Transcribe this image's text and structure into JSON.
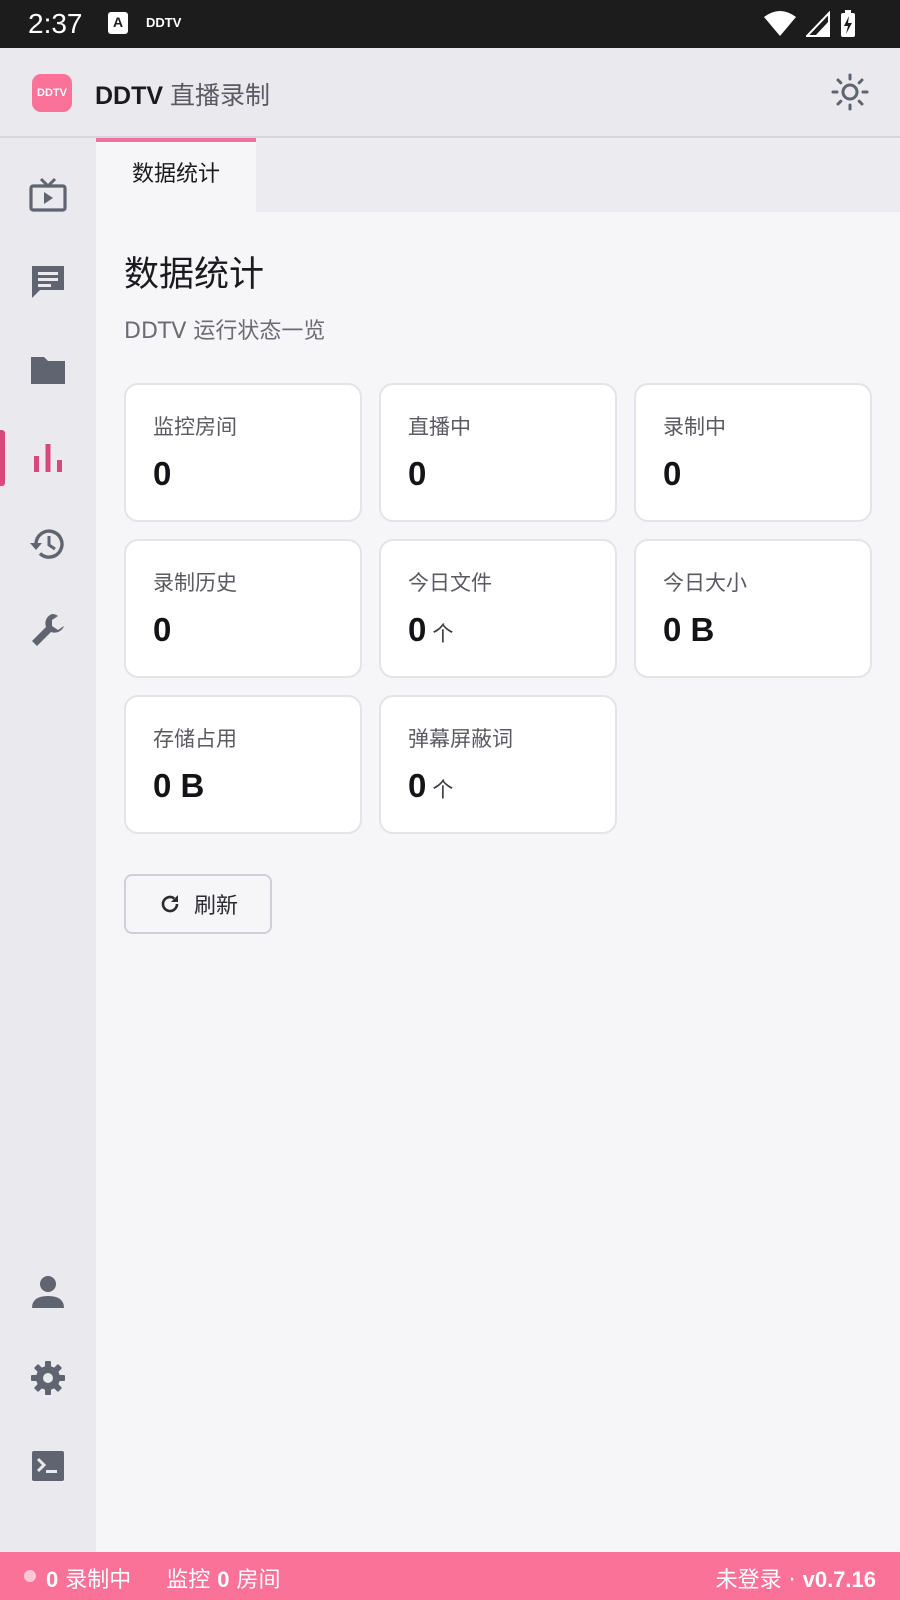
{
  "status_bar": {
    "time": "2:37",
    "notification_a": "A",
    "notification_app": "DDTV"
  },
  "header": {
    "logo_text": "DDTV",
    "title_brand": "DDTV",
    "title_rest": "直播录制",
    "theme_icon": "sun-icon"
  },
  "sidebar": {
    "top_items": [
      {
        "icon": "live-tv-icon"
      },
      {
        "icon": "chat-icon"
      },
      {
        "icon": "folder-icon"
      },
      {
        "icon": "bar-chart-icon",
        "active": true
      },
      {
        "icon": "history-icon"
      },
      {
        "icon": "wrench-icon"
      }
    ],
    "bottom_items": [
      {
        "icon": "person-icon"
      },
      {
        "icon": "settings-icon"
      },
      {
        "icon": "terminal-icon"
      }
    ]
  },
  "tabs": [
    {
      "label": "数据统计",
      "active": true
    }
  ],
  "main": {
    "title": "数据统计",
    "subtitle": "DDTV 运行状态一览",
    "stats": [
      {
        "label": "监控房间",
        "value": "0",
        "unit": ""
      },
      {
        "label": "直播中",
        "value": "0",
        "unit": ""
      },
      {
        "label": "录制中",
        "value": "0",
        "unit": ""
      },
      {
        "label": "录制历史",
        "value": "0",
        "unit": ""
      },
      {
        "label": "今日文件",
        "value": "0",
        "unit": "个"
      },
      {
        "label": "今日大小",
        "value": "0 B",
        "unit": ""
      },
      {
        "label": "存储占用",
        "value": "0 B",
        "unit": ""
      },
      {
        "label": "弹幕屏蔽词",
        "value": "0",
        "unit": "个"
      }
    ],
    "refresh_label": "刷新"
  },
  "footer": {
    "recording_count": "0",
    "recording_label": "录制中",
    "monitor_prefix": "监控",
    "monitor_count": "0",
    "monitor_suffix": "房间",
    "login_status": "未登录",
    "separator": "·",
    "version": "v0.7.16"
  },
  "colors": {
    "accent": "#fb7299",
    "active_nav": "#d9487a",
    "icon_gray": "#5f6470"
  }
}
